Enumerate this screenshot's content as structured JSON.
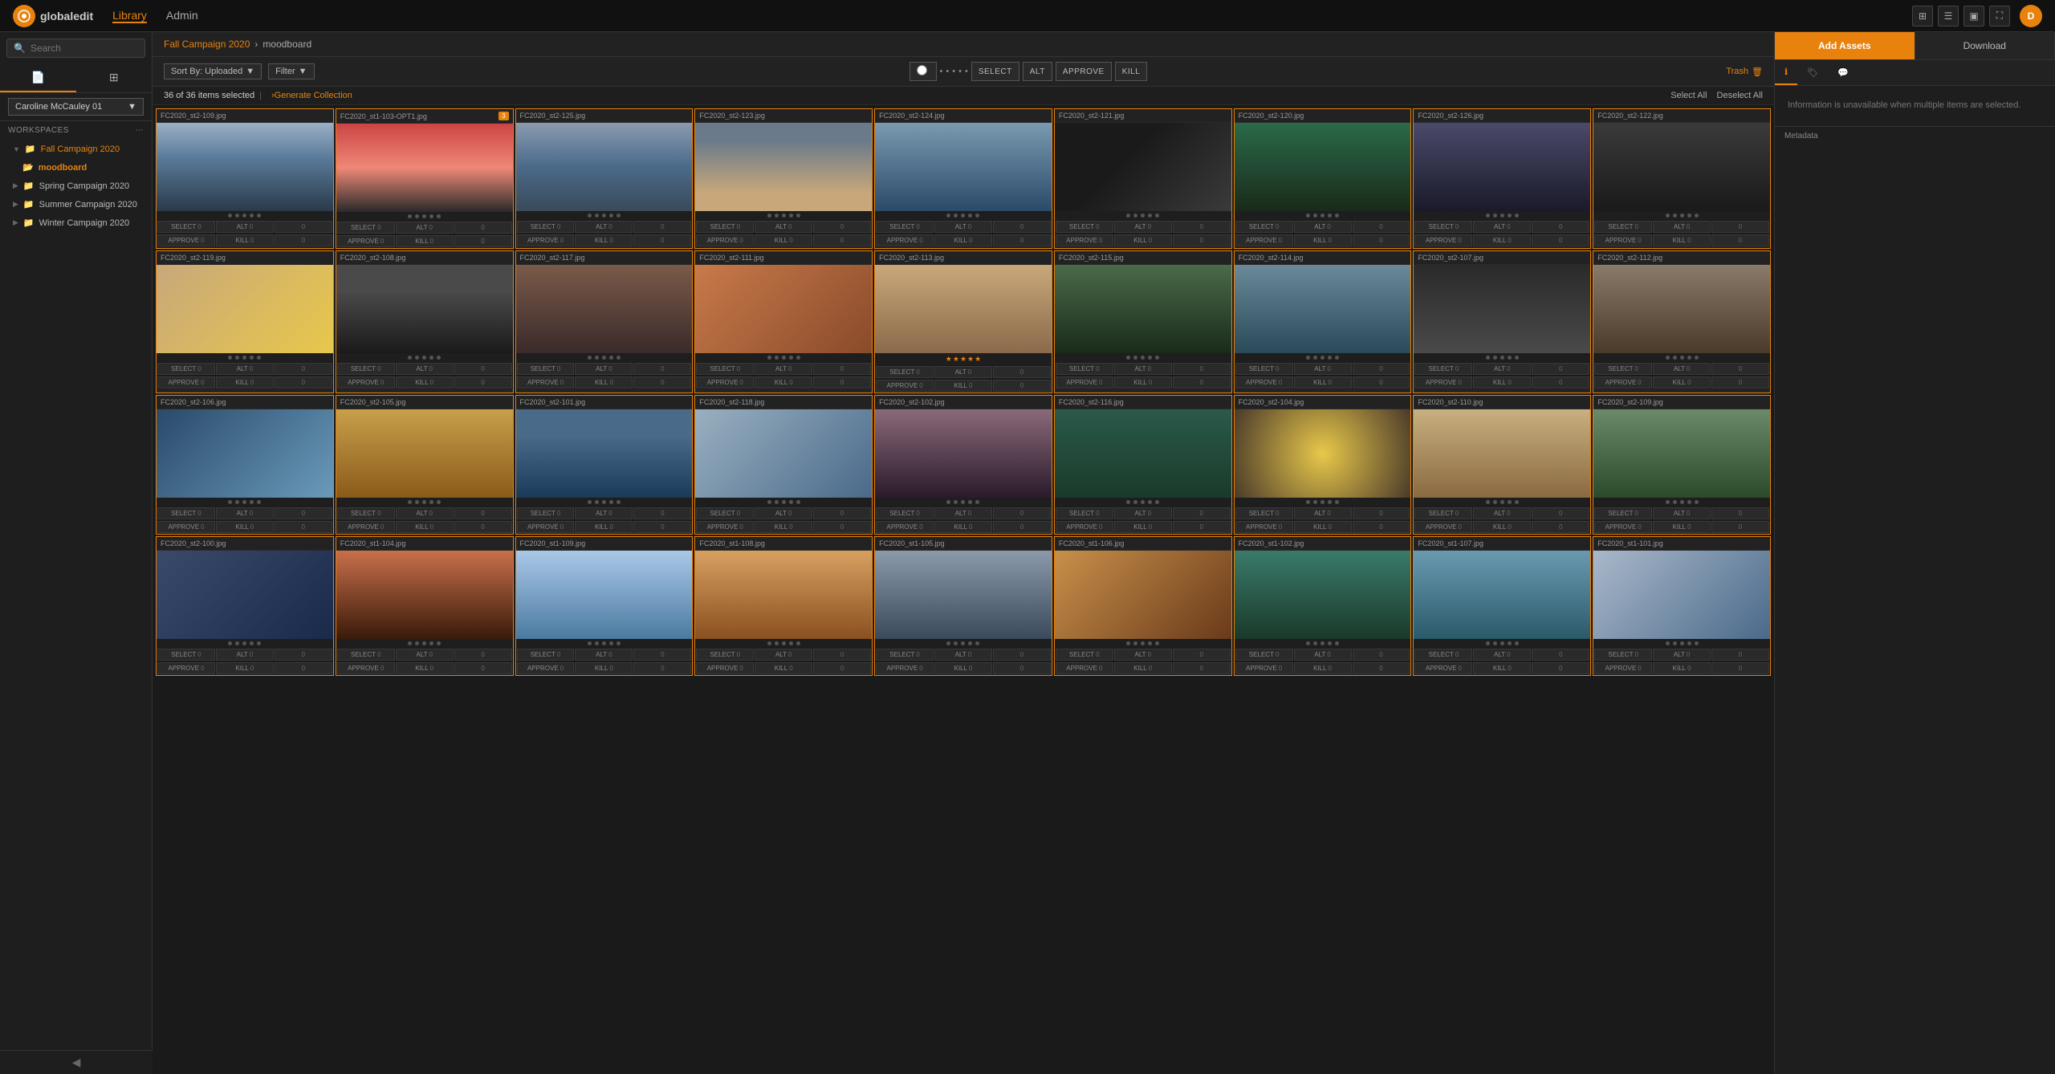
{
  "app": {
    "name": "globaledit",
    "logo_initial": "g"
  },
  "nav": {
    "library_label": "Library",
    "admin_label": "Admin",
    "active": "Library"
  },
  "breadcrumb": {
    "root": "Fall Campaign 2020",
    "separator": "›",
    "current": "moodboard"
  },
  "toolbar": {
    "sort_label": "Sort By: Uploaded",
    "filter_label": "Filter",
    "select_label": "SELECT",
    "alt_label": "ALT",
    "approve_label": "APPROVE",
    "kill_label": "KILL"
  },
  "selection": {
    "count": "36 of 36 items selected",
    "separator": "|",
    "generate_label": "›Generate Collection",
    "select_all_label": "Select All",
    "deselect_all_label": "Deselect All",
    "trash_label": "Trash"
  },
  "right_panel": {
    "add_assets_label": "Add Assets",
    "download_label": "Download",
    "metadata_label": "Metadata",
    "metadata_empty": "Information is unavailable when multiple items are selected."
  },
  "sidebar": {
    "search_placeholder": "Search",
    "user_dropdown": "Caroline McCauley 01",
    "workspaces_label": "WORKSPACES",
    "items": [
      {
        "id": "fall-campaign",
        "label": "Fall Campaign 2020",
        "icon": "📁",
        "expanded": true,
        "active": false
      },
      {
        "id": "moodboard",
        "label": "moodboard",
        "icon": "📂",
        "active": true,
        "sub": true
      },
      {
        "id": "spring-campaign",
        "label": "Spring Campaign 2020",
        "icon": "📁",
        "active": false
      },
      {
        "id": "summer-campaign",
        "label": "Summer Campaign 2020",
        "icon": "📁",
        "active": false
      },
      {
        "id": "winter-campaign",
        "label": "Winter Campaign 2020",
        "icon": "📁",
        "active": false
      }
    ]
  },
  "photos": [
    {
      "filename": "FC2020_st2-109.jpg",
      "thumb_class": "t1",
      "selected": true
    },
    {
      "filename": "FC2020_st1-103-OPT1.jpg",
      "thumb_class": "t2",
      "selected": true,
      "badge": "3"
    },
    {
      "filename": "FC2020_st2-125.jpg",
      "thumb_class": "t3",
      "selected": true
    },
    {
      "filename": "FC2020_st2-123.jpg",
      "thumb_class": "t4",
      "selected": true
    },
    {
      "filename": "FC2020_st2-124.jpg",
      "thumb_class": "t5",
      "selected": true
    },
    {
      "filename": "FC2020_st2-121.jpg",
      "thumb_class": "t6",
      "selected": true
    },
    {
      "filename": "FC2020_st2-120.jpg",
      "thumb_class": "t7",
      "selected": true
    },
    {
      "filename": "FC2020_st2-126.jpg",
      "thumb_class": "t8",
      "selected": true
    },
    {
      "filename": "FC2020_st2-122.jpg",
      "thumb_class": "t9",
      "selected": true
    },
    {
      "filename": "FC2020_st2-119.jpg",
      "thumb_class": "t10",
      "selected": true
    },
    {
      "filename": "FC2020_st2-108.jpg",
      "thumb_class": "t11",
      "selected": true
    },
    {
      "filename": "FC2020_st2-117.jpg",
      "thumb_class": "t12",
      "selected": true
    },
    {
      "filename": "FC2020_st2-111.jpg",
      "thumb_class": "t13",
      "selected": true
    },
    {
      "filename": "FC2020_st2-113.jpg",
      "thumb_class": "t14",
      "selected": true,
      "stars": 5
    },
    {
      "filename": "FC2020_st2-115.jpg",
      "thumb_class": "t15",
      "selected": true
    },
    {
      "filename": "FC2020_st2-114.jpg",
      "thumb_class": "t16",
      "selected": true
    },
    {
      "filename": "FC2020_st2-107.jpg",
      "thumb_class": "t17",
      "selected": true
    },
    {
      "filename": "FC2020_st2-112.jpg",
      "thumb_class": "t18",
      "selected": true
    },
    {
      "filename": "FC2020_st2-106.jpg",
      "thumb_class": "t19",
      "selected": true
    },
    {
      "filename": "FC2020_st2-105.jpg",
      "thumb_class": "t20",
      "selected": true
    },
    {
      "filename": "FC2020_st2-101.jpg",
      "thumb_class": "t21",
      "selected": true
    },
    {
      "filename": "FC2020_st2-118.jpg",
      "thumb_class": "t22",
      "selected": true
    },
    {
      "filename": "FC2020_st2-102.jpg",
      "thumb_class": "t23",
      "selected": true
    },
    {
      "filename": "FC2020_st2-116.jpg",
      "thumb_class": "t24",
      "selected": true
    },
    {
      "filename": "FC2020_st2-104.jpg",
      "thumb_class": "t25",
      "selected": true
    },
    {
      "filename": "FC2020_st2-110.jpg",
      "thumb_class": "t26",
      "selected": true
    },
    {
      "filename": "FC2020_st2-109.jpg",
      "thumb_class": "t27",
      "selected": true
    },
    {
      "filename": "FC2020_st2-100.jpg",
      "thumb_class": "t28",
      "selected": true
    },
    {
      "filename": "FC2020_st1-104.jpg",
      "thumb_class": "t29",
      "selected": true
    },
    {
      "filename": "FC2020_st1-109.jpg",
      "thumb_class": "t30",
      "selected": true
    },
    {
      "filename": "FC2020_st1-108.jpg",
      "thumb_class": "t31",
      "selected": true
    },
    {
      "filename": "FC2020_st1-105.jpg",
      "thumb_class": "t32",
      "selected": true
    },
    {
      "filename": "FC2020_st1-106.jpg",
      "thumb_class": "t33",
      "selected": true
    },
    {
      "filename": "FC2020_st1-102.jpg",
      "thumb_class": "t34",
      "selected": true
    },
    {
      "filename": "FC2020_st1-107.jpg",
      "thumb_class": "t35",
      "selected": true
    },
    {
      "filename": "FC2020_st1-101.jpg",
      "thumb_class": "t36",
      "selected": true
    }
  ]
}
